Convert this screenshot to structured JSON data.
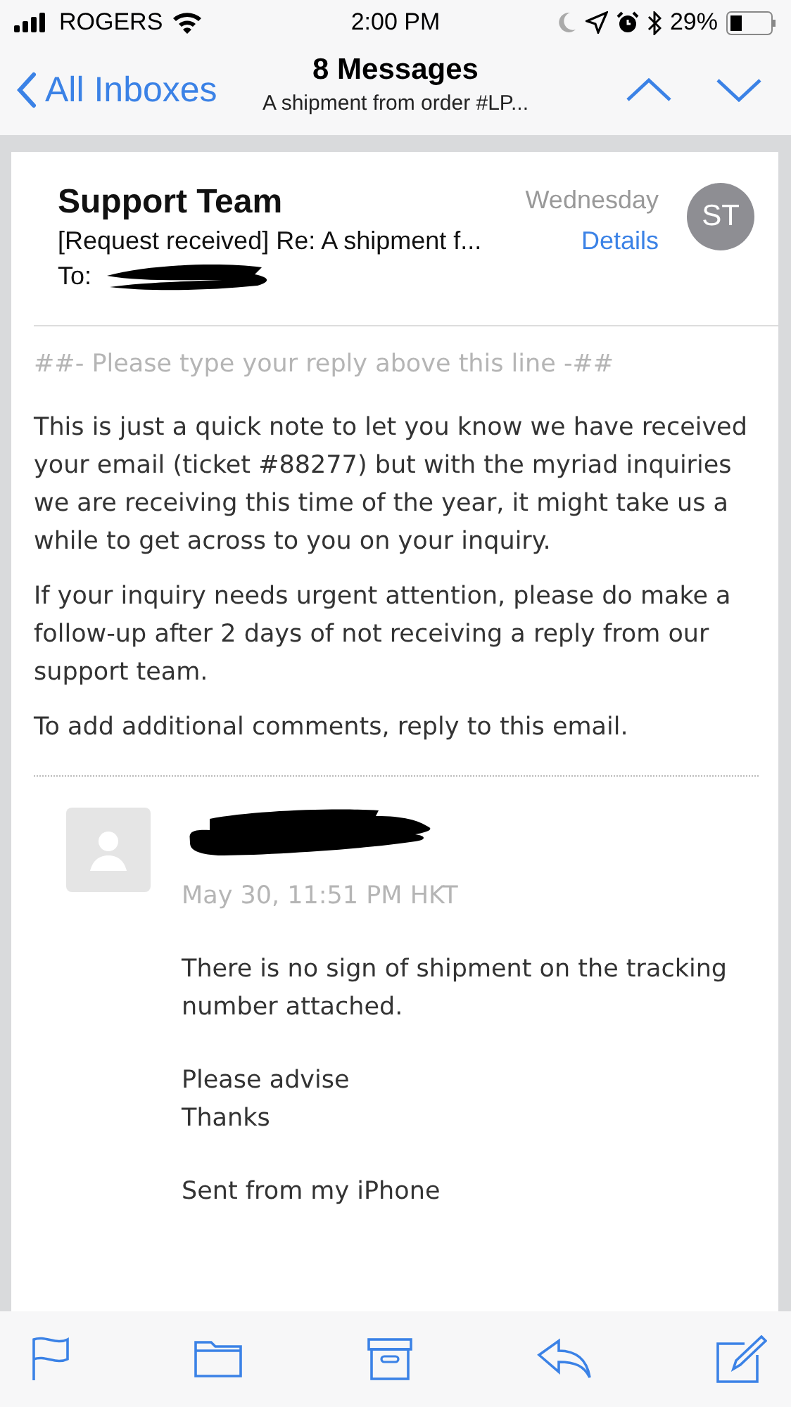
{
  "status_bar": {
    "carrier": "ROGERS",
    "time": "2:00 PM",
    "battery": "29%"
  },
  "nav": {
    "back": "All Inboxes",
    "title": "8 Messages",
    "subtitle": "A shipment from order #LP..."
  },
  "message": {
    "sender": "Support Team",
    "date": "Wednesday",
    "subject": "[Request received] Re: A shipment f...",
    "details": "Details",
    "to_label": "To:",
    "avatar": "ST",
    "quote_marker": "##- Please type your reply above this line -##",
    "paragraphs": [
      "This is just a quick note to let you know we have received your email (ticket #88277) but with the myriad inquiries we are receiving this time of the year, it might take us a while to get across to you on your inquiry.",
      "If your inquiry needs urgent attention, please do make a follow-up after 2 days of not receiving a reply from our support team.",
      "To add additional comments, reply to this email."
    ]
  },
  "reply": {
    "date": "May 30, 11:51 PM HKT",
    "lines": [
      "There is no sign of shipment on the tracking number attached.",
      "Please advise\nThanks",
      "Sent from my iPhone"
    ]
  }
}
